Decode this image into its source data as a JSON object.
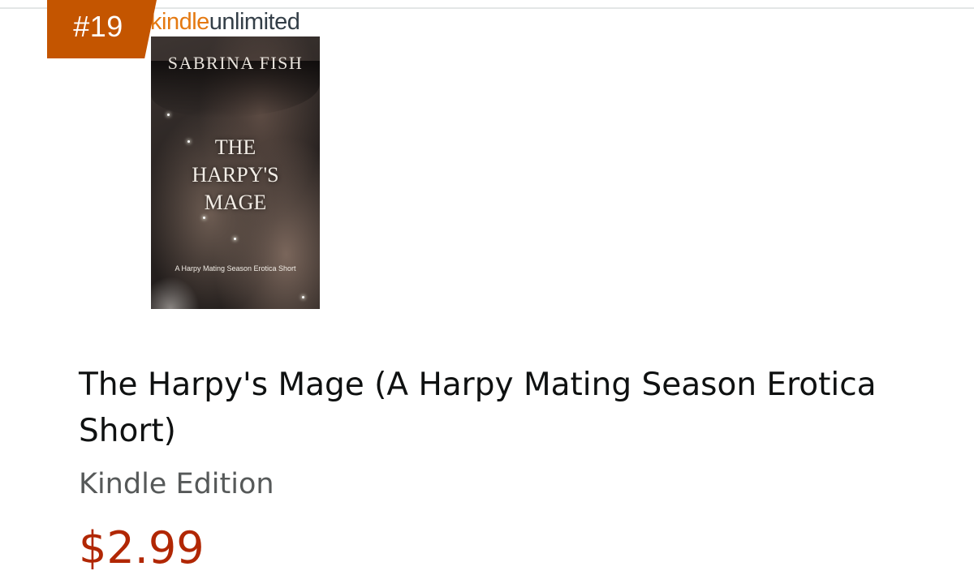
{
  "product": {
    "rank": "#19",
    "program_logo": {
      "part1": "kindle",
      "part2": "unlimited"
    },
    "cover": {
      "author": "SABRINA FISH",
      "title_lines": [
        "THE",
        "HARPY'S",
        "MAGE"
      ],
      "tagline": "A Harpy Mating Season Erotica Short"
    },
    "title": "The Harpy's Mage (A Harpy Mating Season Erotica Short)",
    "format": "Kindle Edition",
    "price": "$2.99"
  },
  "colors": {
    "badge": "#c45500",
    "price": "#b12704",
    "title": "#0f1111",
    "format": "#565959",
    "kindle_orange": "#e47911"
  }
}
